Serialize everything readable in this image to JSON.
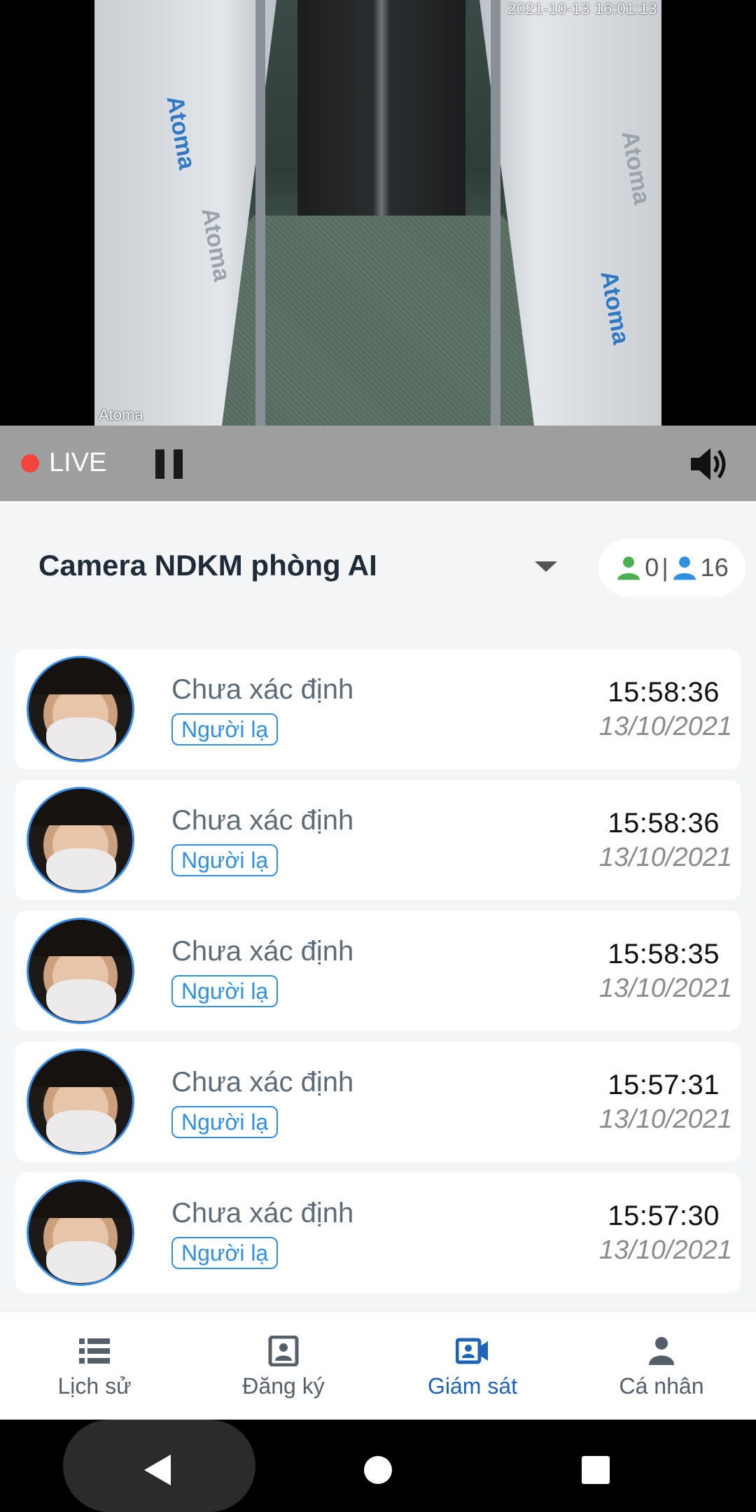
{
  "video": {
    "timestamp": "2021-10-13 16:01:13",
    "watermark": "Atoma",
    "brand_texts": [
      "Atoma",
      "Atoma",
      "Atoma",
      "Atoma"
    ]
  },
  "controls": {
    "live_label": "LIVE",
    "pause_icon": "pause-icon",
    "volume_icon": "volume-icon",
    "live_color": "#f2443a"
  },
  "camera": {
    "name": "Camera NDKM phòng AI",
    "known_count": "0",
    "separator": "|",
    "stranger_count": "16",
    "known_color": "#4caf50",
    "stranger_color": "#2f8fe0"
  },
  "events": [
    {
      "name": "Chưa xác định",
      "tag": "Người lạ",
      "time": "15:58:36",
      "date": "13/10/2021"
    },
    {
      "name": "Chưa xác định",
      "tag": "Người lạ",
      "time": "15:58:36",
      "date": "13/10/2021"
    },
    {
      "name": "Chưa xác định",
      "tag": "Người lạ",
      "time": "15:58:35",
      "date": "13/10/2021"
    },
    {
      "name": "Chưa xác định",
      "tag": "Người lạ",
      "time": "15:57:31",
      "date": "13/10/2021"
    },
    {
      "name": "Chưa xác định",
      "tag": "Người lạ",
      "time": "15:57:30",
      "date": "13/10/2021"
    }
  ],
  "nav": {
    "items": [
      {
        "label": "Lịch sử",
        "icon": "list-icon"
      },
      {
        "label": "Đăng ký",
        "icon": "register-icon"
      },
      {
        "label": "Giám sát",
        "icon": "video-camera-icon"
      },
      {
        "label": "Cá nhân",
        "icon": "person-icon"
      }
    ],
    "active_index": 2,
    "active_color": "#1e63b8"
  }
}
